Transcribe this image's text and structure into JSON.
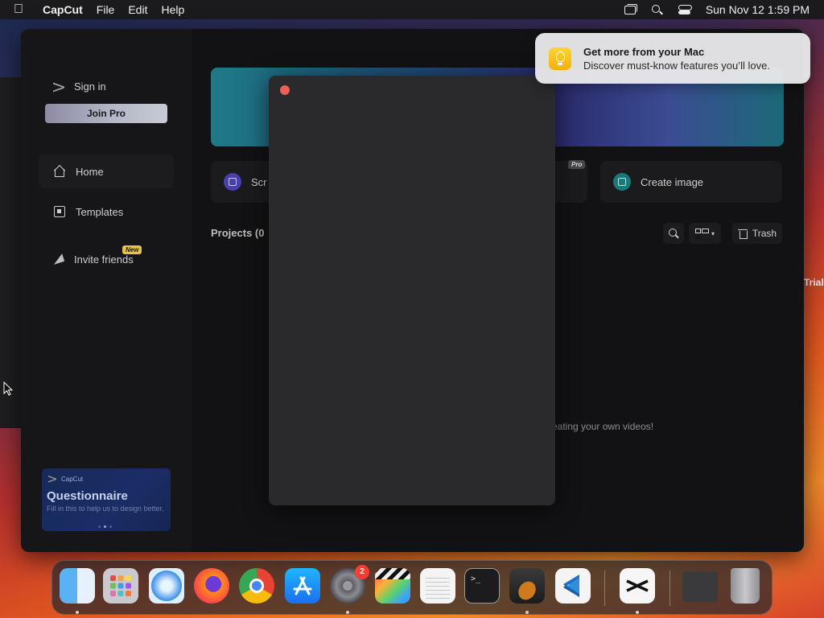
{
  "menubar": {
    "app_name": "CapCut",
    "menus": [
      "File",
      "Edit",
      "Help"
    ],
    "datetime": "Sun Nov 12  1:59 PM"
  },
  "sidebar": {
    "sign_in": "Sign in",
    "join_pro": "Join Pro",
    "nav": [
      {
        "label": "Home",
        "icon": "home-icon"
      },
      {
        "label": "Templates",
        "icon": "templates-icon"
      },
      {
        "label": "Invite friends",
        "icon": "invite-icon",
        "badge": "New"
      }
    ],
    "questionnaire": {
      "brand": "CapCut",
      "title": "Questionnaire",
      "subtitle": "Fill in this to help us to design better."
    }
  },
  "main": {
    "tiles": [
      {
        "label": "Scr",
        "icon": "screen-recorder-icon",
        "color": "#5b4bd1"
      },
      {
        "label": "Create image",
        "icon": "create-image-icon",
        "color": "#1f8e8a"
      }
    ],
    "pro_tag": "Pro",
    "projects_label": "Projects  (0",
    "trash_label": "Trash",
    "empty_hint": "eating your own videos!"
  },
  "notification": {
    "title": "Get more from your Mac",
    "body": "Discover must-know features you’ll love."
  },
  "background_window": {
    "trial_fragment": "Trial"
  },
  "dock": {
    "apps": [
      "Finder",
      "Launchpad",
      "Safari",
      "Firefox",
      "Chrome",
      "App Store",
      "System Settings",
      "Final Cut Pro",
      "TextEdit",
      "Terminal",
      "GarageBand",
      "VS Code",
      "CapCut",
      "Screenshot Window",
      "Trash"
    ],
    "settings_badge": "2"
  }
}
